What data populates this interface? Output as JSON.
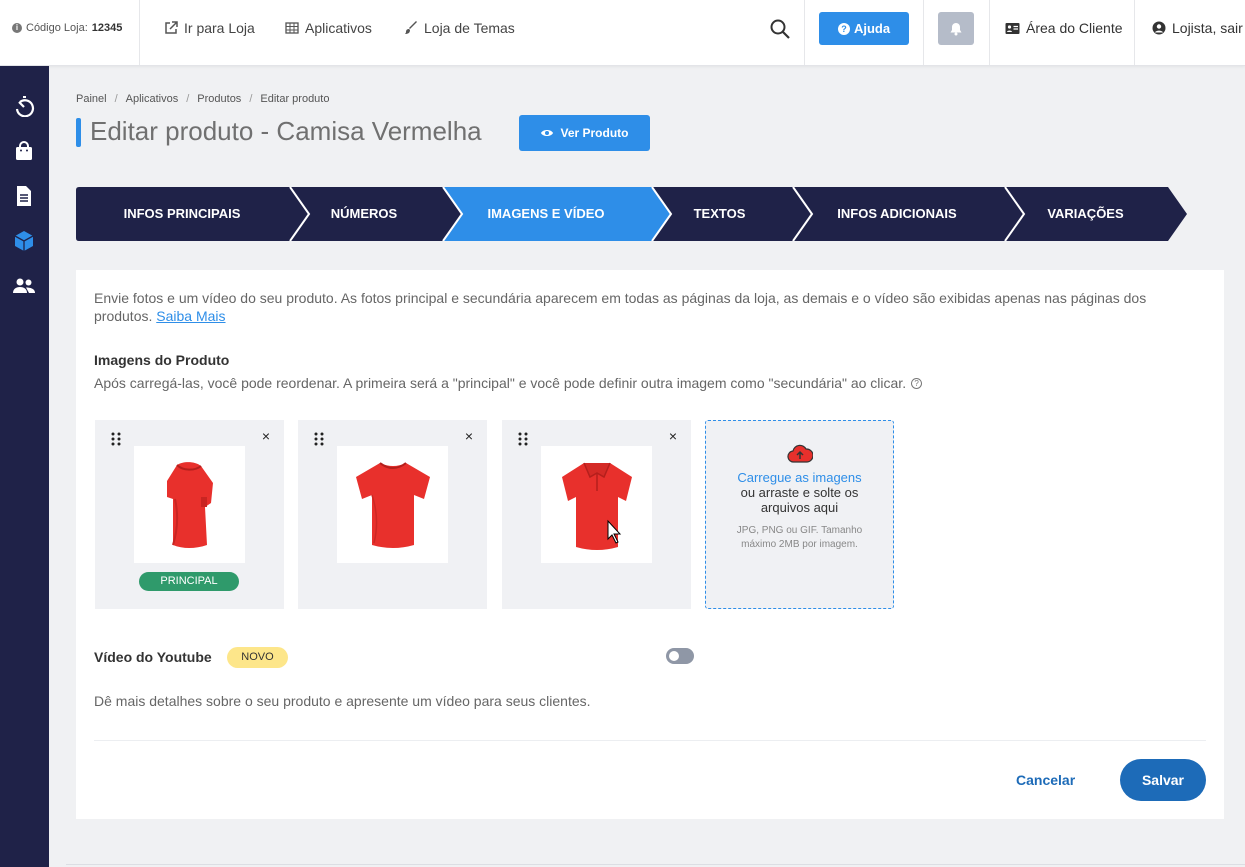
{
  "topbar": {
    "store_code_label": "Código Loja:",
    "store_code": "12345",
    "go_to_store": "Ir para Loja",
    "apps": "Aplicativos",
    "theme_store": "Loja de Temas",
    "help": "Ajuda",
    "client_area": "Área do Cliente",
    "user": "Lojista, sair"
  },
  "sidebar": {
    "icons": [
      "speedometer-icon",
      "shopping-bag-icon",
      "document-icon",
      "box-icon",
      "users-icon"
    ]
  },
  "breadcrumb": [
    "Painel",
    "Aplicativos",
    "Produtos",
    "Editar produto"
  ],
  "page": {
    "title": "Editar produto - Camisa Vermelha",
    "view_button": "Ver Produto"
  },
  "steps": [
    "INFOS PRINCIPAIS",
    "NÚMEROS",
    "IMAGENS E VÍDEO",
    "TEXTOS",
    "INFOS ADICIONAIS",
    "VARIAÇÕES"
  ],
  "active_step": 2,
  "content": {
    "intro": "Envie fotos e um vídeo do seu produto. As fotos principal e secundária aparecem em todas as páginas da loja, as demais e o vídeo são exibidas apenas nas páginas dos produtos.",
    "intro_link": "Saiba Mais",
    "images_title": "Imagens do Produto",
    "images_subtitle": "Após carregá-las, você pode reordenar. A primeira será a \"principal\" e você pode definir outra imagem como \"secundária\" ao clicar.",
    "principal_badge": "PRINCIPAL",
    "upload_link": "Carregue as imagens",
    "upload_text": "ou arraste e solte os arquivos aqui",
    "upload_note": "JPG, PNG ou GIF. Tamanho máximo 2MB por imagem.",
    "youtube_title": "Vídeo do Youtube",
    "youtube_badge": "NOVO",
    "youtube_desc": "Dê mais detalhes sobre o seu produto e apresente um vídeo para seus clientes.",
    "cancel": "Cancelar",
    "save": "Salvar"
  },
  "colors": {
    "navy": "#1f2248",
    "accent": "#2e8ee8",
    "shirt": "#e8302c",
    "success": "#2f9a6b"
  }
}
